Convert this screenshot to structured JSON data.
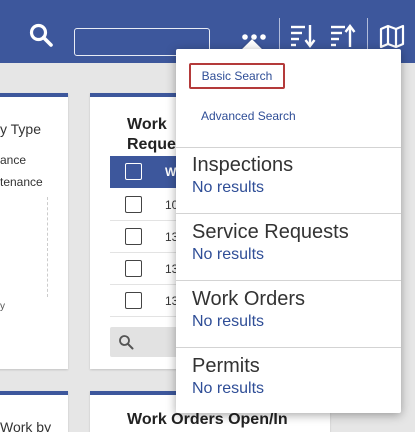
{
  "colors": {
    "header": "#3d579c",
    "accent_link": "#2f4e97",
    "focus_border": "#b43a3a"
  },
  "toolbar": {
    "search_icon": "search-icon",
    "search_value": "",
    "more_icon": "more-horizontal-icon",
    "sort_desc_icon": "sort-descending-icon",
    "sort_asc_icon": "sort-ascending-icon",
    "map_icon": "map-icon"
  },
  "cards": {
    "left": {
      "title": "y Type",
      "items": [
        "ance",
        "tenance"
      ],
      "axis_mark": "y"
    },
    "mid": {
      "title_line1": "Work",
      "title_line2": "Reque",
      "header_label": "W",
      "rows": [
        "10",
        "13",
        "13",
        "13"
      ]
    },
    "left_bottom": {
      "title": "Work by"
    },
    "mid_bottom": {
      "title": "Work Orders Open/In"
    }
  },
  "popup": {
    "basic_search": "Basic Search",
    "advanced_search": "Advanced Search",
    "sections": [
      {
        "title": "Inspections",
        "result": "No results"
      },
      {
        "title": "Service Requests",
        "result": "No results"
      },
      {
        "title": "Work Orders",
        "result": "No results"
      },
      {
        "title": "Permits",
        "result": "No results"
      }
    ]
  }
}
